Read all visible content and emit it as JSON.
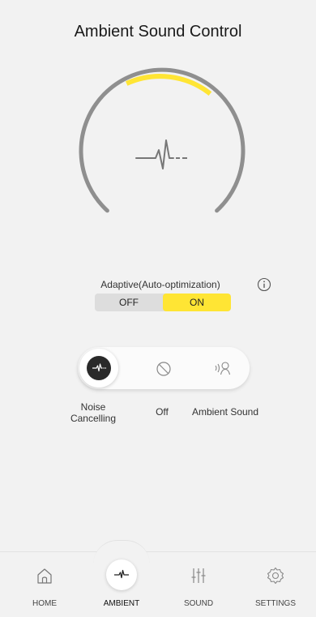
{
  "header": {
    "title": "Ambient Sound Control"
  },
  "gauge": {
    "level_fraction": 0.5,
    "track_color": "#999999",
    "highlight_color": "#ffe534",
    "center_icon": "noise-cancelling-wave-icon"
  },
  "adaptive": {
    "label": "Adaptive(Auto-optimization)",
    "info_icon": "info-icon",
    "off_label": "OFF",
    "on_label": "ON",
    "selected": "ON"
  },
  "modes": {
    "selected": "Noise Cancelling",
    "items": [
      {
        "icon": "noise-cancelling-icon",
        "label": "Noise Cancelling"
      },
      {
        "icon": "off-icon",
        "label": "Off"
      },
      {
        "icon": "ambient-sound-icon",
        "label": "Ambient Sound"
      }
    ]
  },
  "tabbar": {
    "selected": "AMBIENT",
    "tabs": [
      {
        "icon": "home-icon",
        "label": "HOME"
      },
      {
        "icon": "ambient-icon",
        "label": "AMBIENT"
      },
      {
        "icon": "equalizer-icon",
        "label": "SOUND"
      },
      {
        "icon": "gear-icon",
        "label": "SETTINGS"
      }
    ]
  },
  "colors": {
    "accent": "#ffe534",
    "background": "#f2f2f2"
  }
}
